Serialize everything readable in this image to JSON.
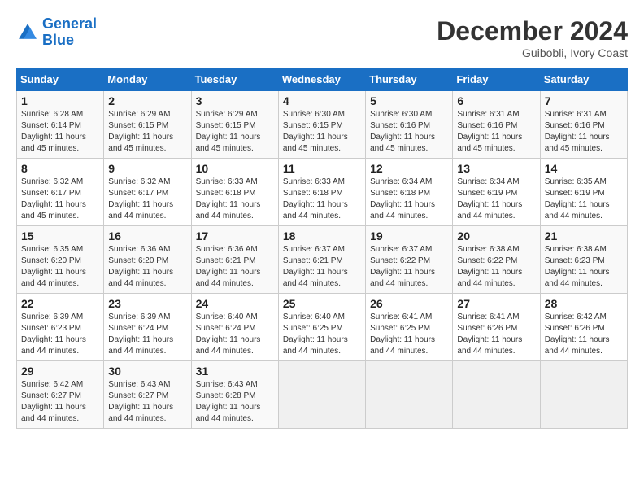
{
  "header": {
    "logo_line1": "General",
    "logo_line2": "Blue",
    "month": "December 2024",
    "location": "Guibobli, Ivory Coast"
  },
  "weekdays": [
    "Sunday",
    "Monday",
    "Tuesday",
    "Wednesday",
    "Thursday",
    "Friday",
    "Saturday"
  ],
  "weeks": [
    [
      {
        "day": "1",
        "sunrise": "6:28 AM",
        "sunset": "6:14 PM",
        "daylight": "11 hours and 45 minutes."
      },
      {
        "day": "2",
        "sunrise": "6:29 AM",
        "sunset": "6:15 PM",
        "daylight": "11 hours and 45 minutes."
      },
      {
        "day": "3",
        "sunrise": "6:29 AM",
        "sunset": "6:15 PM",
        "daylight": "11 hours and 45 minutes."
      },
      {
        "day": "4",
        "sunrise": "6:30 AM",
        "sunset": "6:15 PM",
        "daylight": "11 hours and 45 minutes."
      },
      {
        "day": "5",
        "sunrise": "6:30 AM",
        "sunset": "6:16 PM",
        "daylight": "11 hours and 45 minutes."
      },
      {
        "day": "6",
        "sunrise": "6:31 AM",
        "sunset": "6:16 PM",
        "daylight": "11 hours and 45 minutes."
      },
      {
        "day": "7",
        "sunrise": "6:31 AM",
        "sunset": "6:16 PM",
        "daylight": "11 hours and 45 minutes."
      }
    ],
    [
      {
        "day": "8",
        "sunrise": "6:32 AM",
        "sunset": "6:17 PM",
        "daylight": "11 hours and 45 minutes."
      },
      {
        "day": "9",
        "sunrise": "6:32 AM",
        "sunset": "6:17 PM",
        "daylight": "11 hours and 44 minutes."
      },
      {
        "day": "10",
        "sunrise": "6:33 AM",
        "sunset": "6:18 PM",
        "daylight": "11 hours and 44 minutes."
      },
      {
        "day": "11",
        "sunrise": "6:33 AM",
        "sunset": "6:18 PM",
        "daylight": "11 hours and 44 minutes."
      },
      {
        "day": "12",
        "sunrise": "6:34 AM",
        "sunset": "6:18 PM",
        "daylight": "11 hours and 44 minutes."
      },
      {
        "day": "13",
        "sunrise": "6:34 AM",
        "sunset": "6:19 PM",
        "daylight": "11 hours and 44 minutes."
      },
      {
        "day": "14",
        "sunrise": "6:35 AM",
        "sunset": "6:19 PM",
        "daylight": "11 hours and 44 minutes."
      }
    ],
    [
      {
        "day": "15",
        "sunrise": "6:35 AM",
        "sunset": "6:20 PM",
        "daylight": "11 hours and 44 minutes."
      },
      {
        "day": "16",
        "sunrise": "6:36 AM",
        "sunset": "6:20 PM",
        "daylight": "11 hours and 44 minutes."
      },
      {
        "day": "17",
        "sunrise": "6:36 AM",
        "sunset": "6:21 PM",
        "daylight": "11 hours and 44 minutes."
      },
      {
        "day": "18",
        "sunrise": "6:37 AM",
        "sunset": "6:21 PM",
        "daylight": "11 hours and 44 minutes."
      },
      {
        "day": "19",
        "sunrise": "6:37 AM",
        "sunset": "6:22 PM",
        "daylight": "11 hours and 44 minutes."
      },
      {
        "day": "20",
        "sunrise": "6:38 AM",
        "sunset": "6:22 PM",
        "daylight": "11 hours and 44 minutes."
      },
      {
        "day": "21",
        "sunrise": "6:38 AM",
        "sunset": "6:23 PM",
        "daylight": "11 hours and 44 minutes."
      }
    ],
    [
      {
        "day": "22",
        "sunrise": "6:39 AM",
        "sunset": "6:23 PM",
        "daylight": "11 hours and 44 minutes."
      },
      {
        "day": "23",
        "sunrise": "6:39 AM",
        "sunset": "6:24 PM",
        "daylight": "11 hours and 44 minutes."
      },
      {
        "day": "24",
        "sunrise": "6:40 AM",
        "sunset": "6:24 PM",
        "daylight": "11 hours and 44 minutes."
      },
      {
        "day": "25",
        "sunrise": "6:40 AM",
        "sunset": "6:25 PM",
        "daylight": "11 hours and 44 minutes."
      },
      {
        "day": "26",
        "sunrise": "6:41 AM",
        "sunset": "6:25 PM",
        "daylight": "11 hours and 44 minutes."
      },
      {
        "day": "27",
        "sunrise": "6:41 AM",
        "sunset": "6:26 PM",
        "daylight": "11 hours and 44 minutes."
      },
      {
        "day": "28",
        "sunrise": "6:42 AM",
        "sunset": "6:26 PM",
        "daylight": "11 hours and 44 minutes."
      }
    ],
    [
      {
        "day": "29",
        "sunrise": "6:42 AM",
        "sunset": "6:27 PM",
        "daylight": "11 hours and 44 minutes."
      },
      {
        "day": "30",
        "sunrise": "6:43 AM",
        "sunset": "6:27 PM",
        "daylight": "11 hours and 44 minutes."
      },
      {
        "day": "31",
        "sunrise": "6:43 AM",
        "sunset": "6:28 PM",
        "daylight": "11 hours and 44 minutes."
      },
      null,
      null,
      null,
      null
    ]
  ]
}
